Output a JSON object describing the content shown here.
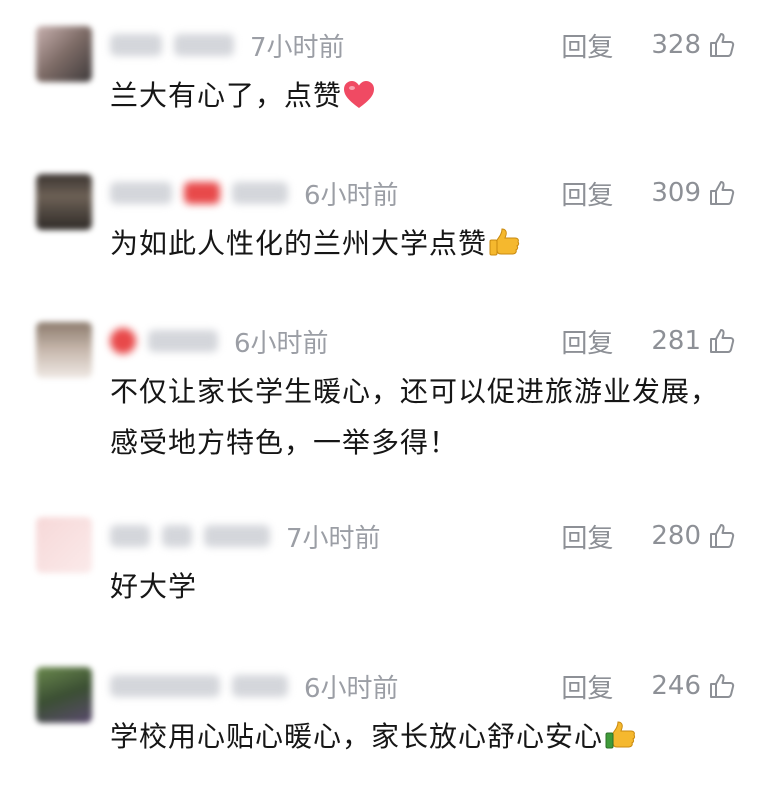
{
  "comments": [
    {
      "time": "7小时前",
      "reply_label": "回复",
      "likes": "328",
      "text": "兰大有心了，点赞",
      "emoji": "heart-emoji"
    },
    {
      "time": "6小时前",
      "reply_label": "回复",
      "likes": "309",
      "text": "为如此人性化的兰州大学点赞",
      "emoji": "thumbs-up-emoji"
    },
    {
      "time": "6小时前",
      "reply_label": "回复",
      "likes": "281",
      "text": "不仅让家长学生暖心，还可以促进旅游业发展，感受地方特色，一举多得！",
      "emoji": ""
    },
    {
      "time": "7小时前",
      "reply_label": "回复",
      "likes": "280",
      "text": "好大学",
      "emoji": ""
    },
    {
      "time": "6小时前",
      "reply_label": "回复",
      "likes": "246",
      "text": "学校用心贴心暖心，家长放心舒心安心",
      "emoji": "thumbs-up-emoji"
    }
  ],
  "colors": {
    "meta_gray": "#9b9ea5",
    "text": "#161616",
    "heart": "#f04a63",
    "thumb_yellow": "#f5b82e"
  }
}
